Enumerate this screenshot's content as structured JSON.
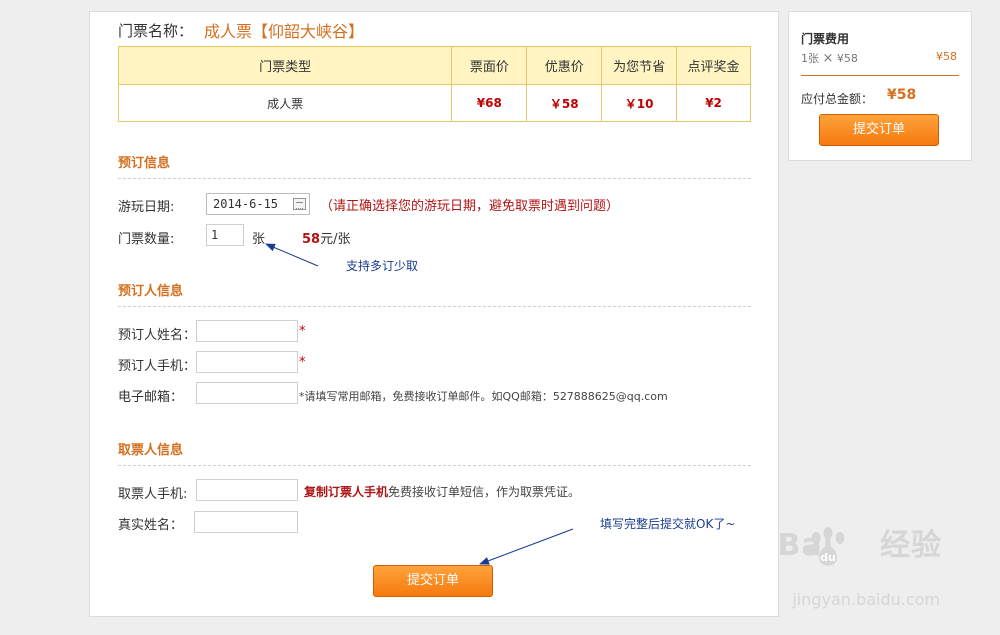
{
  "ticket": {
    "name_label": "门票名称：",
    "name_value": "成人票【仰韶大峡谷】"
  },
  "price_table": {
    "headers": [
      "门票类型",
      "票面价",
      "优惠价",
      "为您节省",
      "点评奖金"
    ],
    "rows": [
      [
        "成人票",
        "¥68",
        "￥58",
        "￥10",
        "¥2"
      ]
    ]
  },
  "booking": {
    "section_title": "预订信息",
    "date_label": "游玩日期:",
    "date_value": "2014-6-15",
    "date_hint": "（请正确选择您的游玩日期，避免取票时遇到问题）",
    "qty_label": "门票数量:",
    "qty_value": "1",
    "qty_unit": "张",
    "unit_price_num": "58",
    "unit_price_suffix": "元/张",
    "annotation": "支持多订少取"
  },
  "orderer": {
    "section_title": "预订人信息",
    "name_label": "预订人姓名：",
    "phone_label": "预订人手机：",
    "email_label": "电子邮箱：",
    "required_mark": "*",
    "email_note": "*请填写常用邮箱，免费接收订单邮件。如QQ邮箱：527888625@qq.com"
  },
  "collector": {
    "section_title": "取票人信息",
    "phone_label": "取票人手机:",
    "copy_link": "复制订票人手机",
    "phone_note": "免费接收订单短信，作为取票凭证。",
    "realname_label": "真实姓名：",
    "annotation": "填写完整后提交就OK了~"
  },
  "submit_label": "提交订单",
  "sidebar": {
    "title": "门票费用",
    "line_qty": "1张",
    "line_times": "×",
    "line_unit": "¥58",
    "line_price": "¥58",
    "total_label": "应付总金额：",
    "total_value": "¥58",
    "submit_label": "提交订单"
  },
  "watermark": {
    "brand": "Bai",
    "brand_suffix": "经验",
    "url": "jingyan.baidu.com"
  },
  "colors": {
    "accent": "#d4701f",
    "price_red": "#c00000",
    "annotation_blue": "#1a3c90"
  }
}
